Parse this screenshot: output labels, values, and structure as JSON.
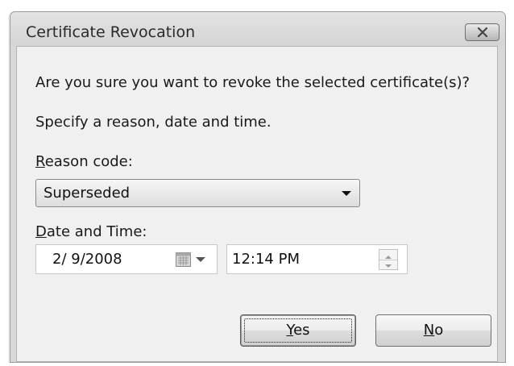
{
  "window": {
    "title": "Certificate Revocation",
    "close_icon": "close-x-icon"
  },
  "dialog": {
    "question": "Are you sure you want to revoke the selected certificate(s)?",
    "instruction": "Specify a reason, date and time."
  },
  "reason": {
    "label_accel": "R",
    "label_rest": "eason code:",
    "selected": "Superseded",
    "dropdown_icon": "chevron-down-icon"
  },
  "datetime": {
    "label_accel": "D",
    "label_rest": "ate and Time:",
    "date_value": "2/ 9/2008",
    "time_value": "12:14 PM",
    "calendar_icon": "calendar-icon",
    "spinner_icon": "spinner-icon"
  },
  "buttons": {
    "yes_accel": "Y",
    "yes_rest": "es",
    "no_accel": "N",
    "no_rest": "o"
  },
  "colors": {
    "window_frame": "#d8d8d8",
    "client_bg": "#f0f0f0",
    "field_bg": "#ffffff",
    "text": "#1a1a1a"
  }
}
